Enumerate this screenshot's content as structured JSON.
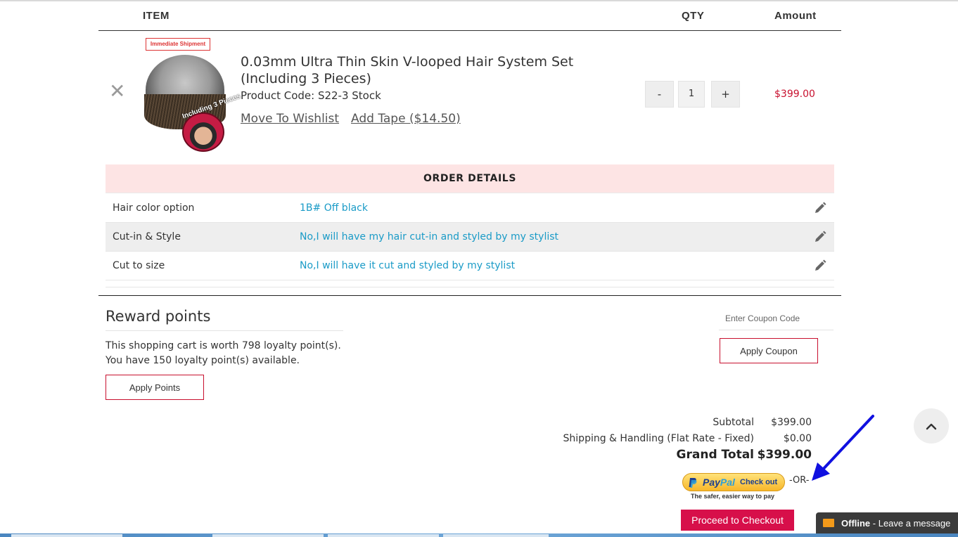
{
  "table_header": {
    "item": "ITEM",
    "qty": "QTY",
    "amount": "Amount"
  },
  "product": {
    "remove_glyph": "✕",
    "image_ribbon": "Immediate Shipment",
    "image_caption": "Including 3 Pieces",
    "title": "0.03mm Ultra Thin Skin V-looped Hair System Set (Including 3 Pieces)",
    "code": "Product Code: S22-3 Stock",
    "wishlist_link": "Move To Wishlist",
    "tape_link": "Add Tape ($14.50)",
    "qty_minus": "-",
    "qty_value": "1",
    "qty_plus": "+",
    "price": "$399.00",
    "price_color": "#c8102e"
  },
  "order_details": {
    "heading": "ORDER DETAILS",
    "rows": [
      {
        "label": "Hair color option",
        "value": "1B# Off black"
      },
      {
        "label": "Cut-in & Style",
        "value": "No,I will have my hair cut-in and styled by my stylist"
      },
      {
        "label": "Cut to size",
        "value": "No,I will have it cut and styled by my stylist"
      }
    ],
    "edit_icon": "pencil-icon",
    "value_color": "#1a9bc7"
  },
  "rewards": {
    "title": "Reward points",
    "line1": "This shopping cart is worth 798 loyalty point(s).",
    "line2": "You have 150 loyalty point(s) available.",
    "apply_label": "Apply Points"
  },
  "coupon": {
    "placeholder": "Enter Coupon Code",
    "apply_label": "Apply Coupon"
  },
  "totals": {
    "subtotal_label": "Subtotal",
    "subtotal_value": "$399.00",
    "shipping_label": "Shipping & Handling (Flat Rate - Fixed)",
    "shipping_value": "$0.00",
    "grand_label": "Grand Total",
    "grand_value": "$399.00"
  },
  "paypal": {
    "brand_pay": "Pay",
    "brand_pal": "Pal",
    "checkout_label": "Check out",
    "tagline": "The safer, easier way to pay",
    "or_text": "-OR-"
  },
  "checkout": {
    "label": "Proceed to Checkout",
    "color": "#d70f4a"
  },
  "chat": {
    "status": "Offline",
    "message": " - Leave a message"
  },
  "annotation": {
    "arrow_color": "#1010e0"
  }
}
